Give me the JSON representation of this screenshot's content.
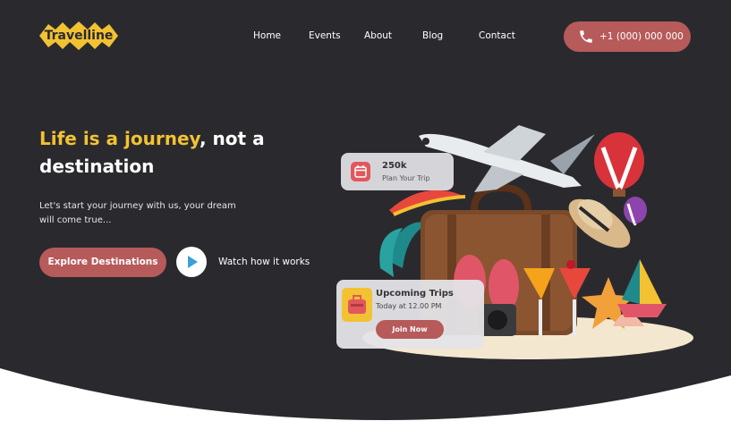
{
  "brand": {
    "name": "Travelline",
    "color": "#f2c233"
  },
  "nav": {
    "items": [
      {
        "label": "Home"
      },
      {
        "label": "Events"
      },
      {
        "label": "About"
      },
      {
        "label": "Blog"
      },
      {
        "label": "Contact"
      }
    ]
  },
  "phone": {
    "label": "+1 (000) 000 000",
    "icon": "phone-icon"
  },
  "hero": {
    "headline_accent": "Life is a journey",
    "headline_rest": ", not a destination",
    "subtext": "Let's start your journey with us, your dream will come true...",
    "cta_label": "Explore Destinations",
    "watch_label": "Watch how it works"
  },
  "trip_card": {
    "value": "250k",
    "label": "Plan Your Trip",
    "icon": "calendar-icon"
  },
  "upcoming_card": {
    "title": "Upcoming Trips",
    "time": "Today at 12.00 PM",
    "button": "Join Now",
    "icon": "suitcase-icon"
  },
  "colors": {
    "background": "#2a2a2e",
    "accent": "#b75a5a",
    "highlight": "#f2c233"
  }
}
